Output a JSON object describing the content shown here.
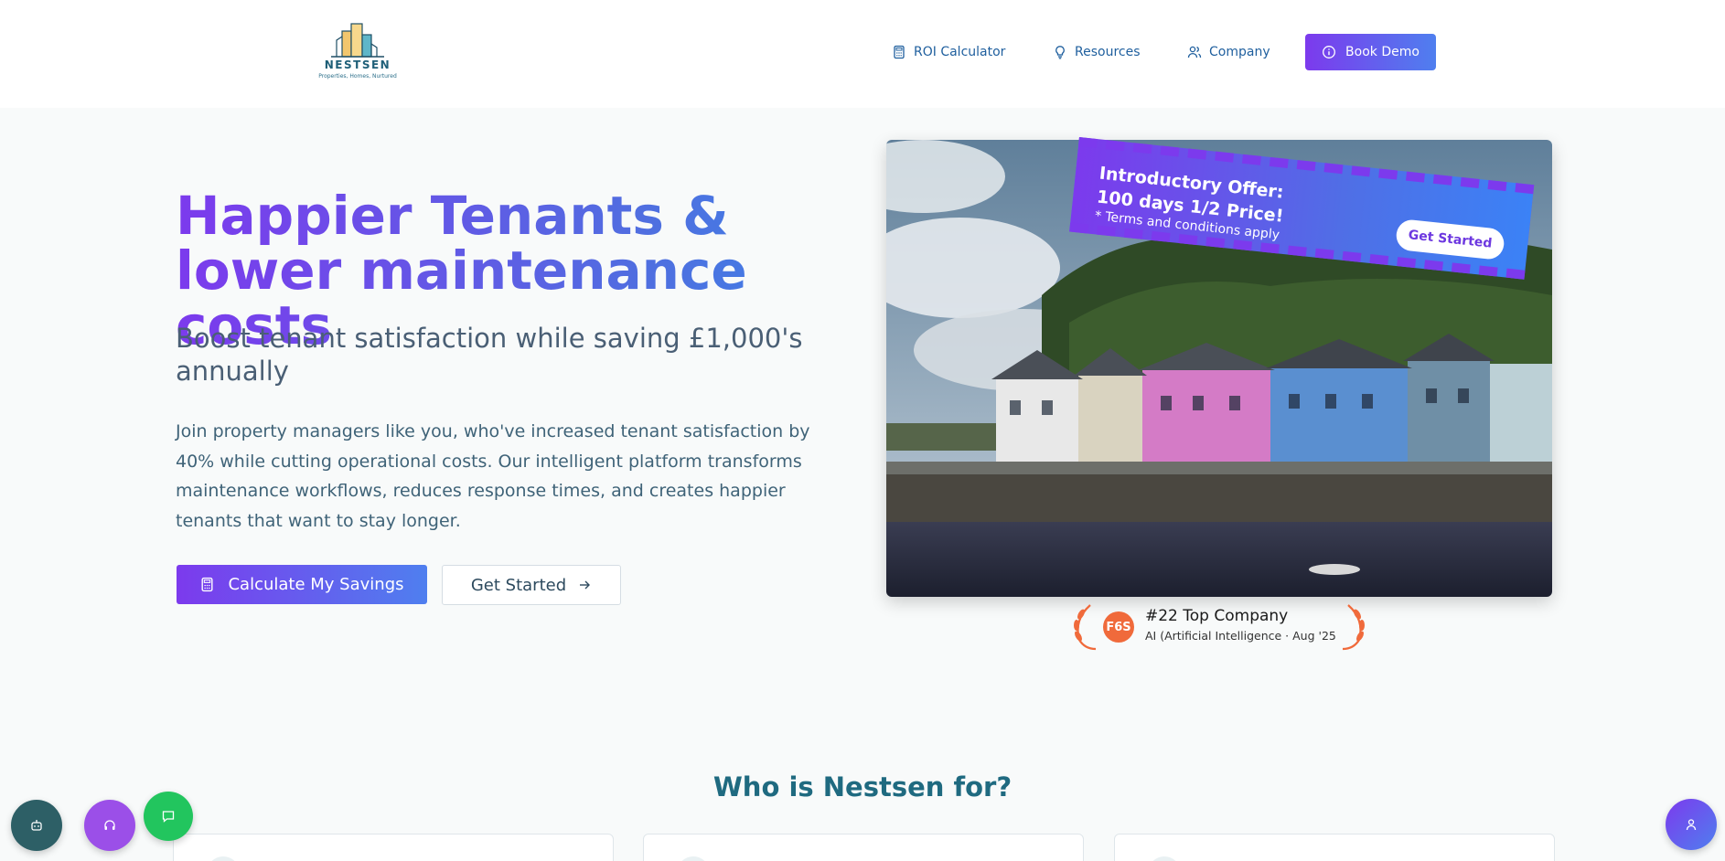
{
  "header": {
    "logo": {
      "word": "NESTSEN",
      "tagline": "Properties, Homes, Nurtured"
    },
    "nav": [
      {
        "label": "ROI Calculator",
        "icon": "calculator-icon"
      },
      {
        "label": "Resources",
        "icon": "lightbulb-icon"
      },
      {
        "label": "Company",
        "icon": "users-icon"
      }
    ],
    "book_demo": "Book Demo"
  },
  "hero": {
    "title": "Happier Tenants & lower maintenance costs",
    "subtitle": "Boost tenant satisfaction while saving £1,000's annually",
    "description": "Join property managers like you, who've increased tenant satisfaction by 40% while cutting operational costs. Our intelligent platform transforms maintenance workflows, reduces response times, and creates happier tenants that want to stay longer.",
    "primary_button": "Calculate My Savings",
    "secondary_button": "Get Started"
  },
  "offer": {
    "line1": "Introductory Offer:",
    "line2": "100 days 1/2 Price!",
    "note": "* Terms and conditions apply",
    "button": "Get Started"
  },
  "award": {
    "logo_text": "F6S",
    "title": "#22 Top Company",
    "subtitle": "AI (Artificial Intelligence · Aug '25"
  },
  "section": {
    "title": "Who is Nestsen for?"
  },
  "colors": {
    "accent_purple": "#7c3aed",
    "accent_blue": "#3b82f6",
    "teal_text": "#1f6a80",
    "chat_green": "#22c55e"
  }
}
